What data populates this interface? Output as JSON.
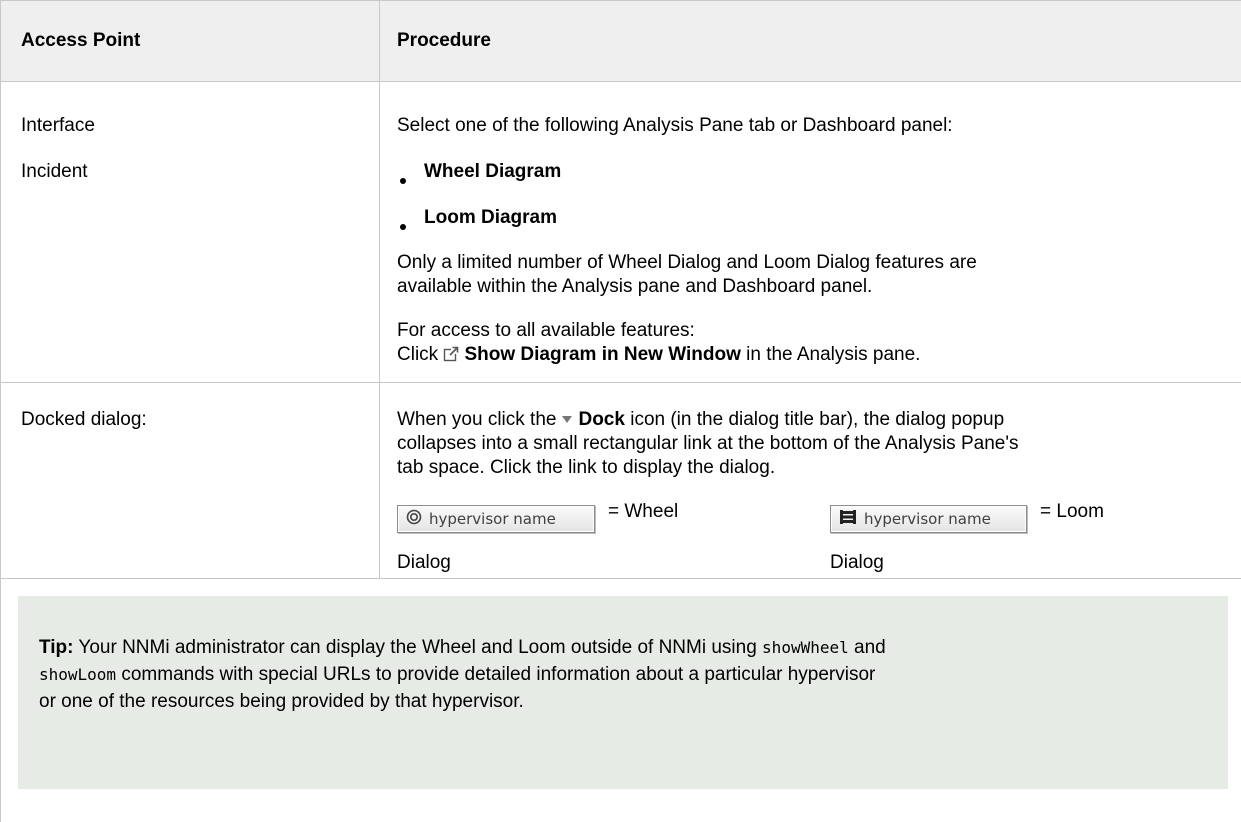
{
  "table": {
    "headers": [
      "Access Point",
      "Procedure"
    ],
    "rows": [
      {
        "access_points": [
          "Interface",
          "Incident"
        ],
        "intro": "Select one of the following Analysis Pane tab or Dashboard panel:",
        "bullets": [
          "Wheel Diagram",
          "Loom Diagram"
        ],
        "limited_line1": "Only a limited number of Wheel Dialog and Loom Dialog features are",
        "limited_line2": "available within the Analysis pane and Dashboard panel.",
        "access_line": "For access to all available features:",
        "click_prefix": "Click",
        "click_bold": "Show Diagram in New Window",
        "click_suffix": "in the Analysis pane.",
        "icons": {
          "external": "external-link-icon"
        }
      },
      {
        "access_point": "Docked dialog:",
        "line1_prefix": "When you click the",
        "line1_bold": "Dock",
        "line1_suffix": "icon (in the dialog title bar), the dialog popup",
        "line2": "collapses into a small rectangular link at the bottom of the Analysis Pane's",
        "line3": "tab space. Click the link to display the dialog.",
        "chips": [
          {
            "label": "hypervisor name",
            "icon": "wheel-icon",
            "suffix": "= Wheel",
            "caption": "Dialog"
          },
          {
            "label": "hypervisor name",
            "icon": "loom-icon",
            "suffix": "= Loom",
            "caption": "Dialog"
          }
        ],
        "icons": {
          "dock": "dock-icon"
        }
      }
    ]
  },
  "tip": {
    "label": "Tip:",
    "text1": "Your NNMi administrator can display the Wheel and Loom outside of NNMi using",
    "code1": "showWheel",
    "text2": "and",
    "code2": "showLoom",
    "text3": "commands with special URLs to provide detailed information about a particular hypervisor",
    "text4": "or one of the resources being provided by that hypervisor."
  },
  "colors": {
    "header_bg": "#efefef",
    "border": "#c8c8c8",
    "tip_bg": "#e6ebe6"
  }
}
